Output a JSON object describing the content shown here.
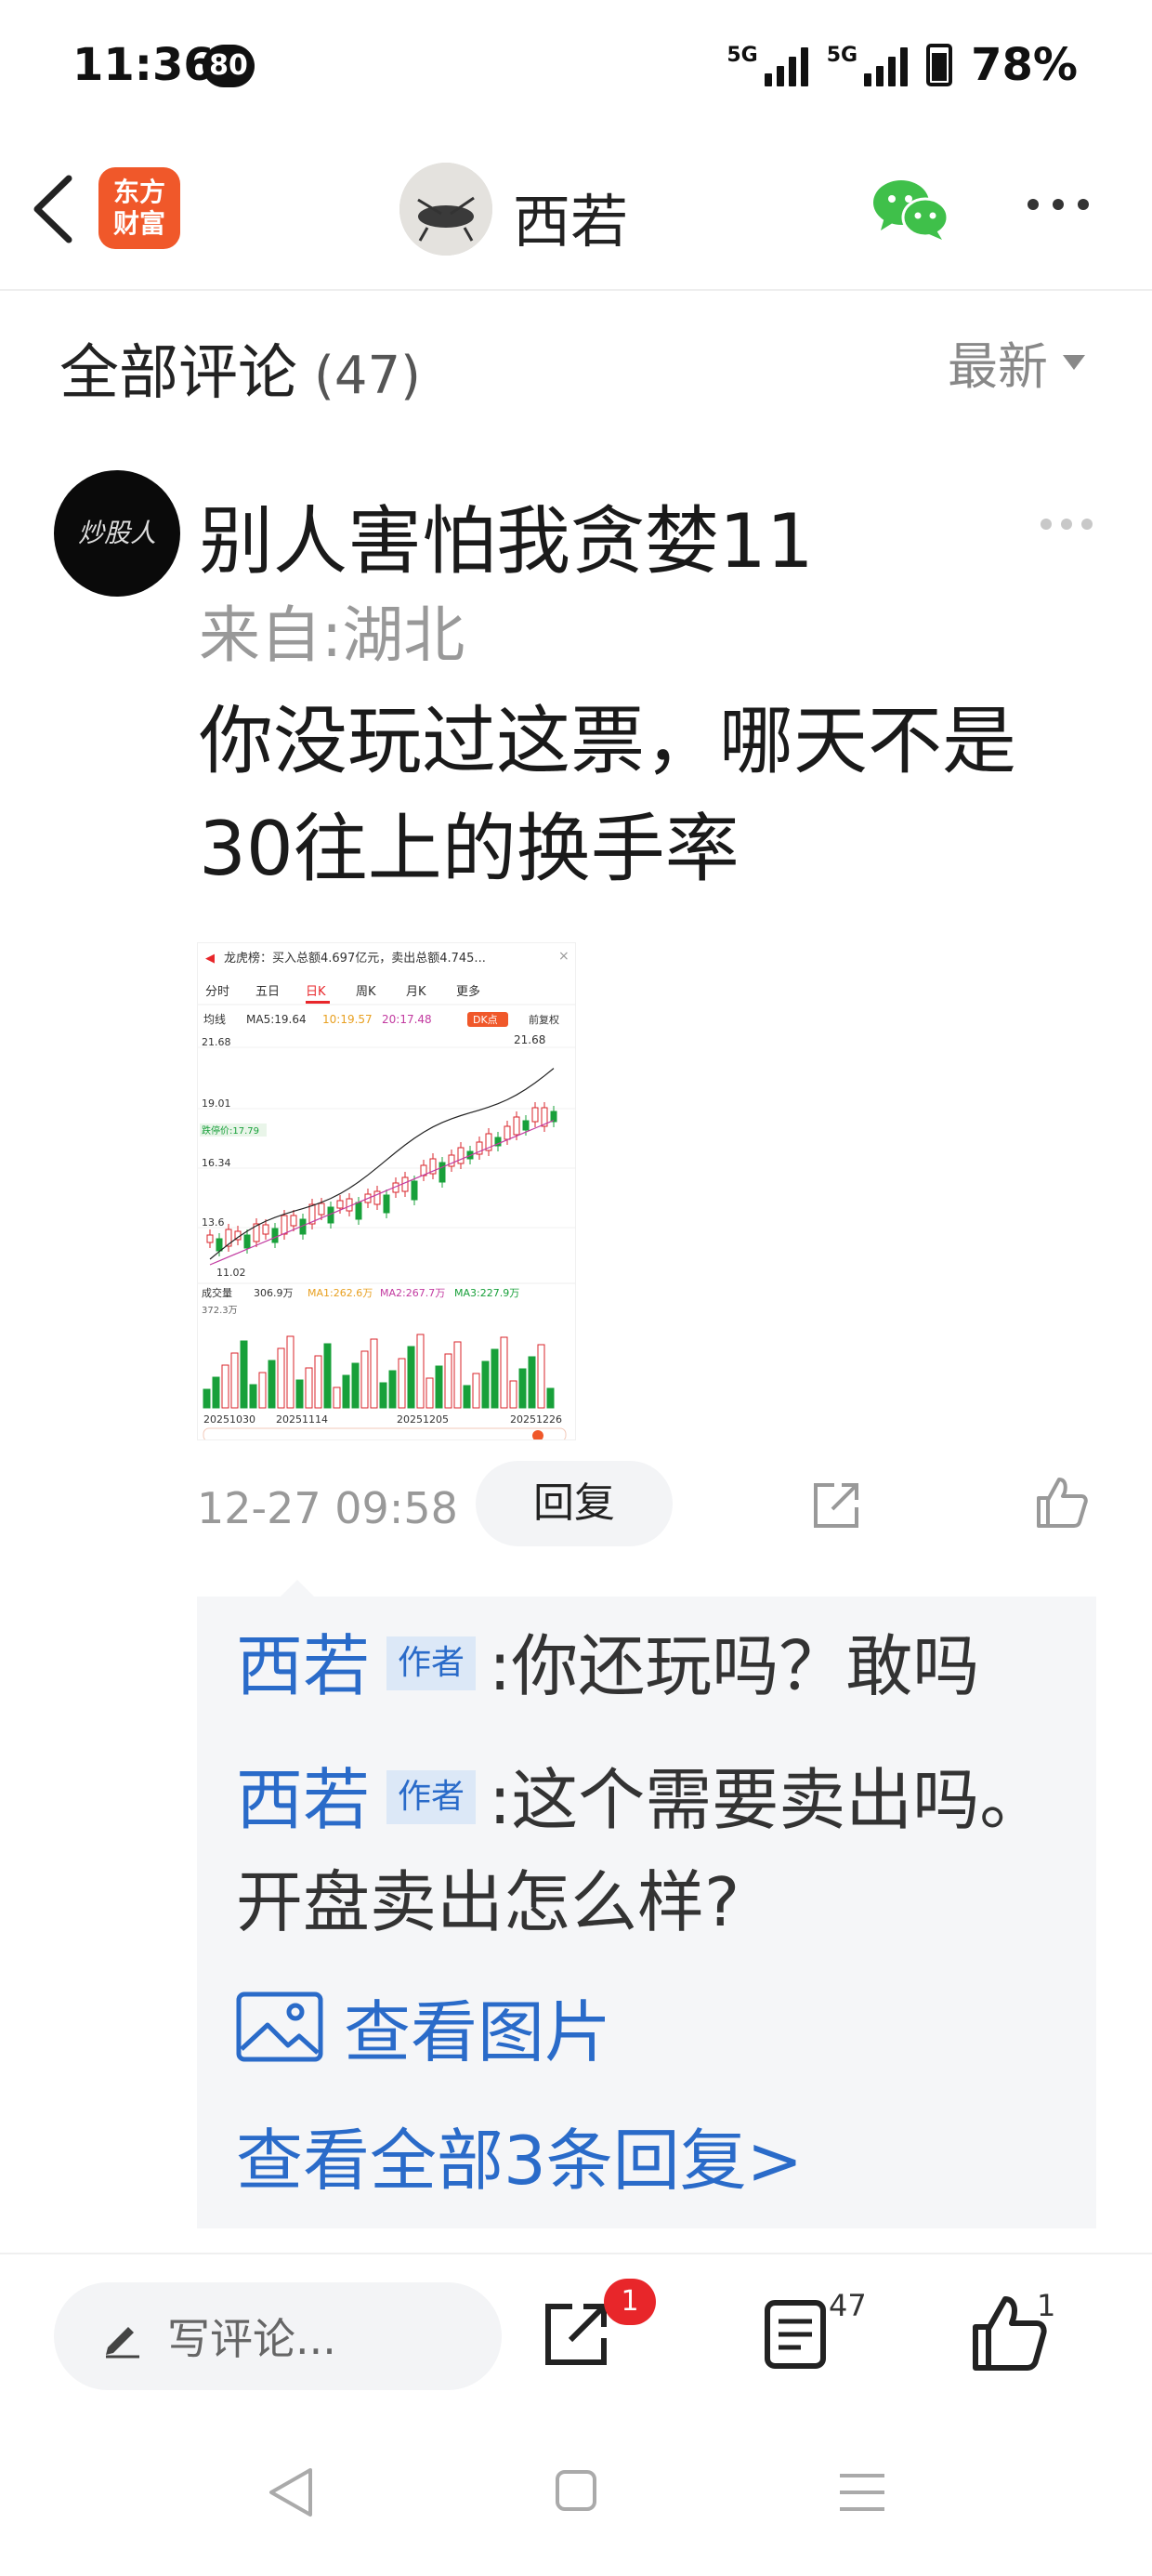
{
  "status_bar": {
    "time": "11:36",
    "badge": "80",
    "network1": "5G",
    "network2": "5G",
    "battery": "78%"
  },
  "header": {
    "logo_line1": "东方",
    "logo_line2": "财富",
    "author_name": "西若",
    "icons": [
      "back-arrow-icon",
      "wechat-icon",
      "more-icon"
    ]
  },
  "comments_header": {
    "title": "全部评论",
    "count": "(47)",
    "sort_label": "最新"
  },
  "comment": {
    "avatar_text": "炒股人",
    "username": "别人害怕我贪婪11",
    "location": "来自:湖北",
    "text": "你没玩过这票，哪天不是30往上的换手率",
    "time": "12-27 09:58",
    "reply_label": "回复",
    "screenshot": {
      "title": "龙虎榜：买入总额4.697亿元，卖出总额4.745...",
      "tabs": [
        "分时",
        "五日",
        "日K",
        "周K",
        "月K",
        "更多"
      ],
      "active_tab": "日K",
      "ma_label": "均线",
      "ma5": "MA5:19.64",
      "ma10": "10:19.57",
      "ma20": "20:17.48",
      "dk_label": "DK点",
      "fq_label": "前复权",
      "price_ticks": [
        "21.68",
        "19.01",
        "16.34",
        "13.6"
      ],
      "limit_label": "跌停价:17.79",
      "low_label": "11.02",
      "high_label": "21.68",
      "vol_label": "成交量",
      "vol_value": "306.9万",
      "vol_ma1": "MA1:262.6万",
      "vol_ma2": "MA2:267.7万",
      "vol_ma3": "MA3:227.9万",
      "vol_tick": "372.3万",
      "dates": [
        "20251030",
        "20251114",
        "20251205",
        "20251226"
      ]
    }
  },
  "replies": {
    "items": [
      {
        "name": "西若",
        "tag": "作者",
        "text": ":你还玩吗？敢吗"
      },
      {
        "name": "西若",
        "tag": "作者",
        "text": ":这个需要卖出吗。开盘卖出怎么样?"
      }
    ],
    "view_image": "查看图片",
    "view_all": "查看全部3条回复>"
  },
  "bottom_bar": {
    "input_placeholder": "写评论...",
    "share_badge": "1",
    "comments_count": "47",
    "likes_count": "1"
  },
  "colors": {
    "brand": "#f0582a",
    "link": "#2a6bc9",
    "badge": "#e8262a",
    "candle_up": "#d8232a",
    "candle_down": "#18a03a"
  }
}
